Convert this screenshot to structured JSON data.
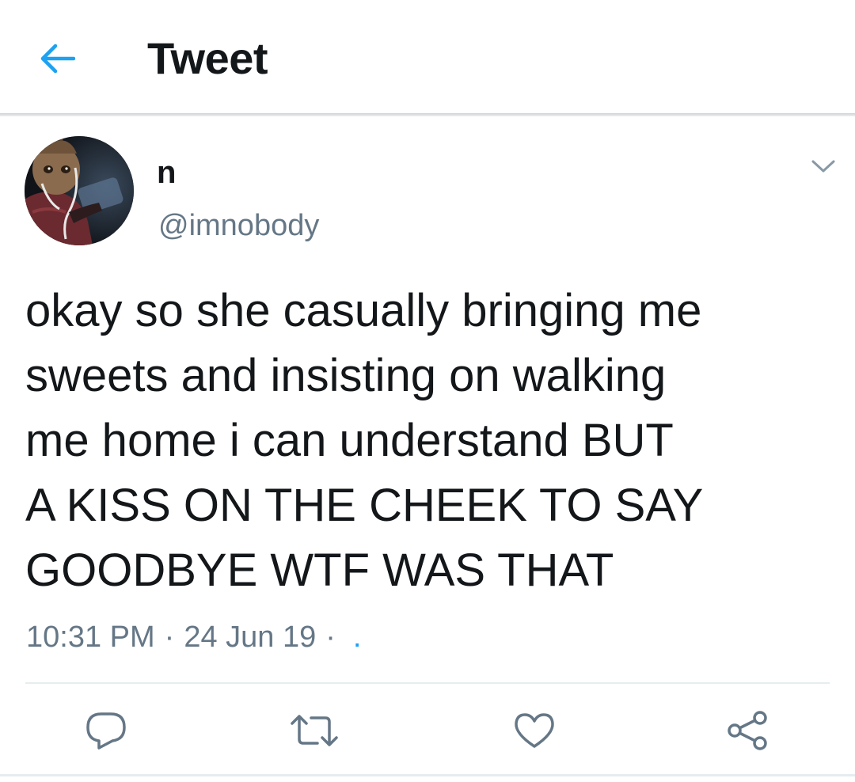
{
  "header": {
    "title": "Tweet",
    "back_icon": "arrow-left-icon"
  },
  "tweet": {
    "author": {
      "display_name": "n",
      "handle": "@imnobody",
      "avatar": "avatar-image"
    },
    "menu_icon": "chevron-down-icon",
    "text": "okay so she casually bringing me\nsweets and insisting on walking\nme home i can understand BUT\nA KISS ON THE CHEEK TO SAY\nGOODBYE WTF WAS THAT",
    "time": "10:31 PM",
    "separator": "·",
    "date": "24 Jun 19",
    "source": "."
  },
  "actions": [
    {
      "name": "reply",
      "icon": "reply-icon"
    },
    {
      "name": "retweet",
      "icon": "retweet-icon"
    },
    {
      "name": "like",
      "icon": "heart-icon"
    },
    {
      "name": "share",
      "icon": "share-icon"
    }
  ],
  "colors": {
    "accent": "#1da1f2",
    "text": "#14171a",
    "secondary": "#657786",
    "divider": "#e6ecf0"
  }
}
